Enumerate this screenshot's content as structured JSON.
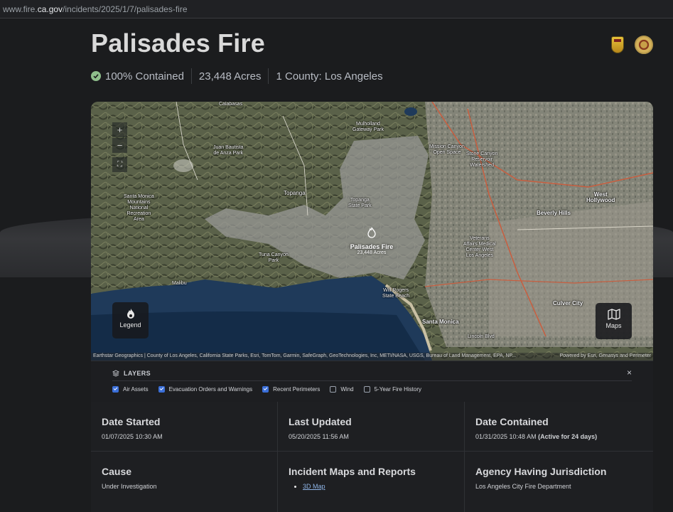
{
  "browser": {
    "url_prefix": "www.fire.",
    "url_host": "ca.gov",
    "url_path": "/incidents/2025/1/7/palisades-fire"
  },
  "incident": {
    "title": "Palisades Fire",
    "contained": "100% Contained",
    "acres": "23,448 Acres",
    "county": "1 County: Los Angeles"
  },
  "map": {
    "fire_name": "Palisades Fire",
    "fire_acres": "23,448 Acres",
    "zoom_in": "+",
    "zoom_out": "−",
    "fullscreen": "⛶",
    "legend_label": "Legend",
    "maps_label": "Maps",
    "attribution": "Earthstar Geographics | County of Los Angeles, California State Parks, Esri, TomTom, Garmin, SafeGraph, GeoTechnologies, Inc, METI/NASA, USGS, Bureau of Land Management, EPA, NP...",
    "powered": "Powered by Esri, Genasys and Perimeter",
    "places": {
      "calabasas": "Calabasas",
      "mulholland": "Mulholland\nGateway Park",
      "juan_bautista": "Juan Bautista\nde Anza Park",
      "topanga": "Topanga",
      "topanga_state": "Topanga\nState Park",
      "santa_monica_mtn": "Santa Monica\nMountains\nNational\nRecreation\nArea",
      "tuna_canyon": "Tuna Canyon\nPark",
      "malibu": "Malibu",
      "will_rogers": "Will Rogers\nState Beach",
      "santa_monica": "Santa Monica",
      "mission_canyon": "Mission Canyon\nOpen Space",
      "stone_canyon": "Stone Canyon\nReservoir\nWatershed",
      "beverly_hills": "Beverly Hills",
      "west_hollywood": "West\nHollywood",
      "culver_city": "Culver City",
      "veterans": "Veterans\nAffairs Medical\nCenter West\nLos Angeles",
      "lincoln": "Lincoln Blvd"
    }
  },
  "layers": {
    "header": "LAYERS",
    "close": "×",
    "options": [
      {
        "label": "Air Assets",
        "checked": true
      },
      {
        "label": "Evacuation Orders and Warnings",
        "checked": true
      },
      {
        "label": "Recent Perimeters",
        "checked": true
      },
      {
        "label": "Wind",
        "checked": false
      },
      {
        "label": "5-Year Fire History",
        "checked": false
      }
    ]
  },
  "details": {
    "date_started": {
      "label": "Date Started",
      "value": "01/07/2025 10:30 AM"
    },
    "last_updated": {
      "label": "Last Updated",
      "value": "05/20/2025 11:56 AM"
    },
    "date_contained": {
      "label": "Date Contained",
      "value": "01/31/2025 10:48 AM",
      "note": "(Active for 24 days)"
    },
    "cause": {
      "label": "Cause",
      "value": "Under Investigation"
    },
    "maps_reports": {
      "label": "Incident Maps and Reports",
      "link": "3D Map"
    },
    "agency": {
      "label": "Agency Having Jurisdiction",
      "value": "Los Angeles City Fire Department"
    }
  },
  "colors": {
    "background": "#1b1c1e",
    "contained_check": "#8fbf8c",
    "checkbox_on": "#3b6fd8",
    "link": "#8eb4e6"
  }
}
